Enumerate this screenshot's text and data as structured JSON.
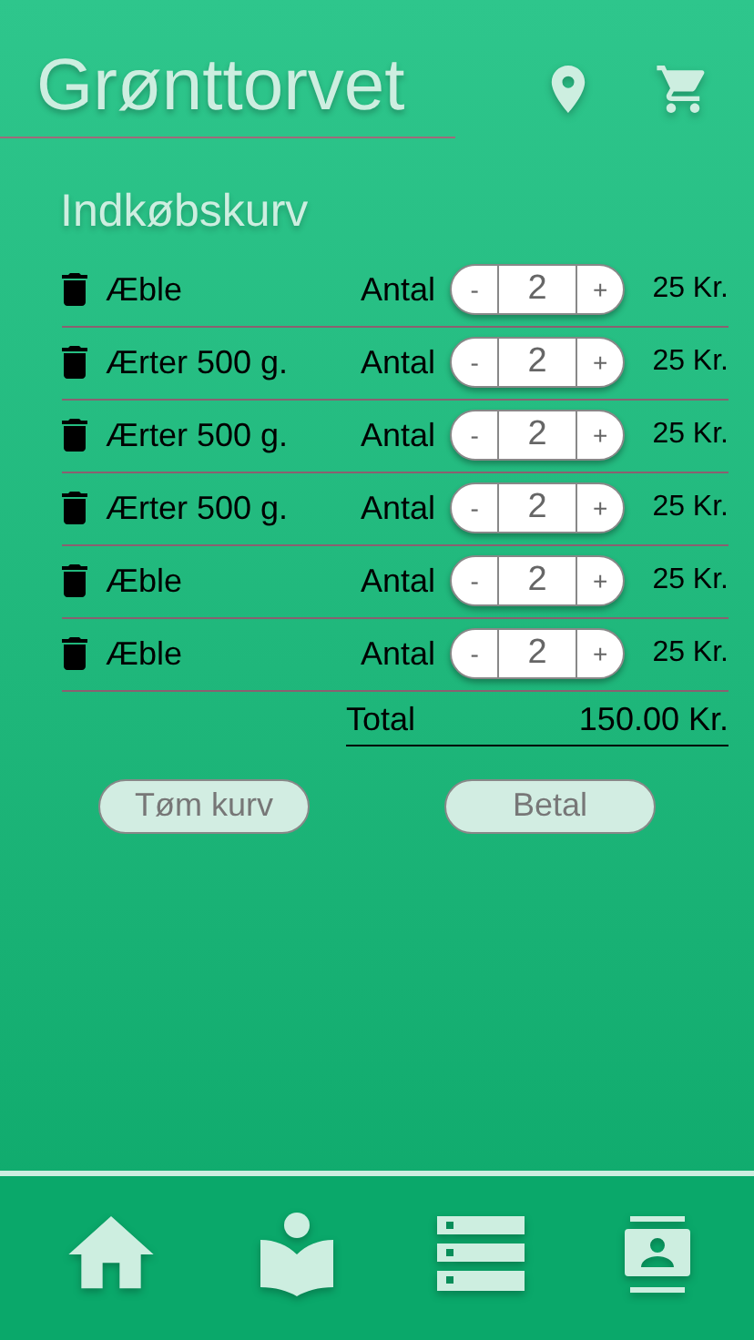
{
  "header": {
    "title": "Grønttorvet"
  },
  "basket": {
    "title": "Indkøbskurv",
    "items": [
      {
        "name": "Æble",
        "qty_label": "Antal",
        "minus": "-",
        "qty": "2",
        "plus": "+",
        "price": "25 Kr."
      },
      {
        "name": "Ærter 500 g.",
        "qty_label": "Antal",
        "minus": "-",
        "qty": "2",
        "plus": "+",
        "price": "25 Kr."
      },
      {
        "name": "Ærter 500 g.",
        "qty_label": "Antal",
        "minus": "-",
        "qty": "2",
        "plus": "+",
        "price": "25 Kr."
      },
      {
        "name": "Ærter 500 g.",
        "qty_label": "Antal",
        "minus": "-",
        "qty": "2",
        "plus": "+",
        "price": "25 Kr."
      },
      {
        "name": "Æble",
        "qty_label": "Antal",
        "minus": "-",
        "qty": "2",
        "plus": "+",
        "price": "25 Kr."
      },
      {
        "name": "Æble",
        "qty_label": "Antal",
        "minus": "-",
        "qty": "2",
        "plus": "+",
        "price": "25 Kr."
      }
    ],
    "total_label": "Total",
    "total": "150.00 Kr.",
    "buttons": [
      "Tøm kurv",
      "Betal"
    ]
  }
}
